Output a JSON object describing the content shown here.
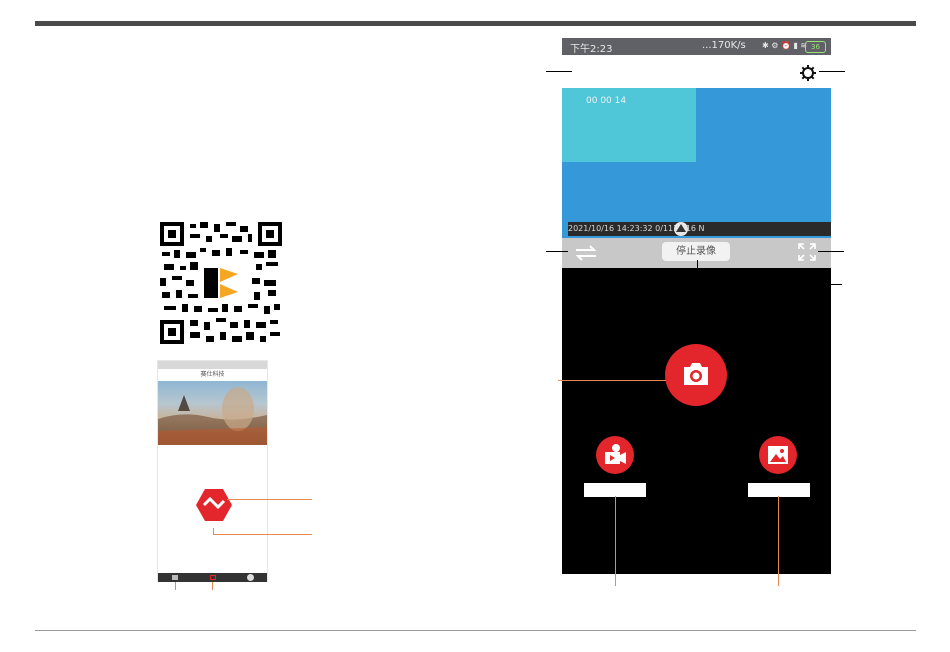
{
  "status_bar": {
    "time": "下午2:23",
    "network_speed": "...170K/s",
    "battery": "36"
  },
  "video": {
    "timer": "00 00 14",
    "osd_text": "2021/10/16  14:23:32  0/111  916  N"
  },
  "controls": {
    "stop_recording_label": "停止录像"
  },
  "mini_app": {
    "title": "赛仕科技"
  },
  "icons": {
    "settings": "gear-icon",
    "switch": "swap-arrows-icon",
    "fullscreen": "expand-icon",
    "snapshot": "camera-icon",
    "record": "video-camera-icon",
    "album": "picture-icon"
  },
  "colors": {
    "accent_red": "#e3262b",
    "callout_orange": "#e58a52",
    "video_blue": "#3598d8",
    "video_cyan": "#4fc7d8"
  }
}
